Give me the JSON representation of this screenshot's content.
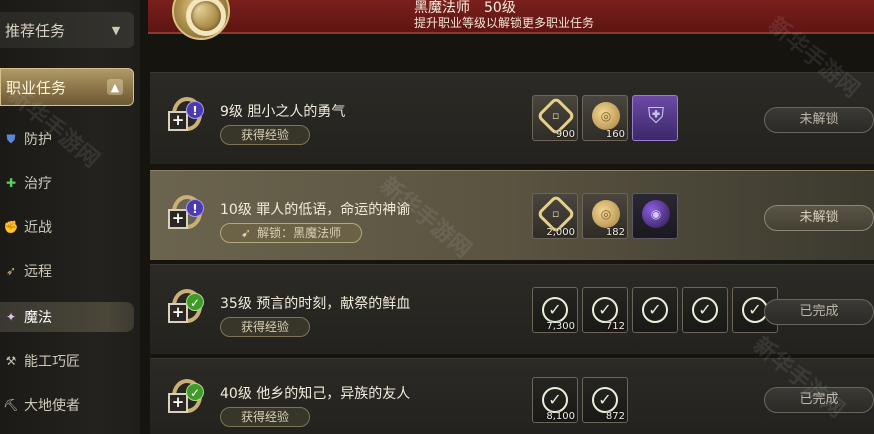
{
  "sidebar": {
    "recommended_header": "推荐任务",
    "job_header": "职业任务",
    "items": [
      {
        "label": "防护",
        "icon": "shield-icon",
        "glyph": "⛊",
        "color": "#5d86d8"
      },
      {
        "label": "治疗",
        "icon": "heal-cross-icon",
        "glyph": "✚",
        "color": "#5ad05a"
      },
      {
        "label": "近战",
        "icon": "fist-icon",
        "glyph": "✊",
        "color": "#d6b27c"
      },
      {
        "label": "远程",
        "icon": "bow-icon",
        "glyph": "➶",
        "color": "#d6b27c"
      },
      {
        "label": "魔法",
        "icon": "wand-icon",
        "glyph": "✦",
        "color": "#e0c3f0"
      },
      {
        "label": "能工巧匠",
        "icon": "hammer-icon",
        "glyph": "⚒",
        "color": "#c8c0b0"
      },
      {
        "label": "大地使者",
        "icon": "pickaxe-icon",
        "glyph": "⛏",
        "color": "#c8c0b0"
      }
    ]
  },
  "banner": {
    "title": "黑魔法师　50级",
    "subtitle": "提升职业等级以解锁更多职业任务"
  },
  "quests": [
    {
      "title": "9级 胆小之人的勇气",
      "pill": "获得经验",
      "status": "未解锁",
      "state": "locked",
      "rewards": [
        {
          "icon": "crystal-icon",
          "qty": "900",
          "kind": "coinA",
          "glyph": "◇"
        },
        {
          "icon": "gil-coin-icon",
          "qty": "160",
          "kind": "coinB",
          "glyph": "◎"
        },
        {
          "icon": "armor-shield-icon",
          "qty": "",
          "kind": "shield",
          "glyph": "⛨"
        }
      ]
    },
    {
      "title": "10级 罪人的低语，命运的神谕",
      "pill": "解锁：黑魔法师",
      "status": "未解锁",
      "state": "locked",
      "rewards": [
        {
          "icon": "crystal-icon",
          "qty": "2,000",
          "kind": "coinA",
          "glyph": "◇"
        },
        {
          "icon": "gil-coin-icon",
          "qty": "182",
          "kind": "coinB",
          "glyph": "◎"
        },
        {
          "icon": "dark-orb-icon",
          "qty": "",
          "kind": "orb",
          "glyph": "◉"
        }
      ]
    },
    {
      "title": "35级 预言的时刻，献祭的鲜血",
      "pill": "获得经验",
      "status": "已完成",
      "state": "done",
      "rewards": [
        {
          "icon": "crystal-icon",
          "qty": "7,300",
          "kind": "done"
        },
        {
          "icon": "gil-coin-icon",
          "qty": "712",
          "kind": "done"
        },
        {
          "icon": "reward-item-icon",
          "qty": "",
          "kind": "done"
        },
        {
          "icon": "reward-item-icon",
          "qty": "",
          "kind": "done"
        },
        {
          "icon": "reward-item-icon",
          "qty": "",
          "kind": "done"
        }
      ]
    },
    {
      "title": "40级 他乡的知己，异族的友人",
      "pill": "获得经验",
      "status": "已完成",
      "state": "done",
      "rewards": [
        {
          "icon": "crystal-icon",
          "qty": "8,100",
          "kind": "done"
        },
        {
          "icon": "gil-coin-icon",
          "qty": "872",
          "kind": "done"
        }
      ]
    }
  ],
  "watermark": "新华手游网",
  "colors": {
    "banner_red": "#6e1a17",
    "gold_accent": "#c9b078",
    "locked_badge": "#4a3bb0",
    "done_badge": "#3f9a2a"
  }
}
